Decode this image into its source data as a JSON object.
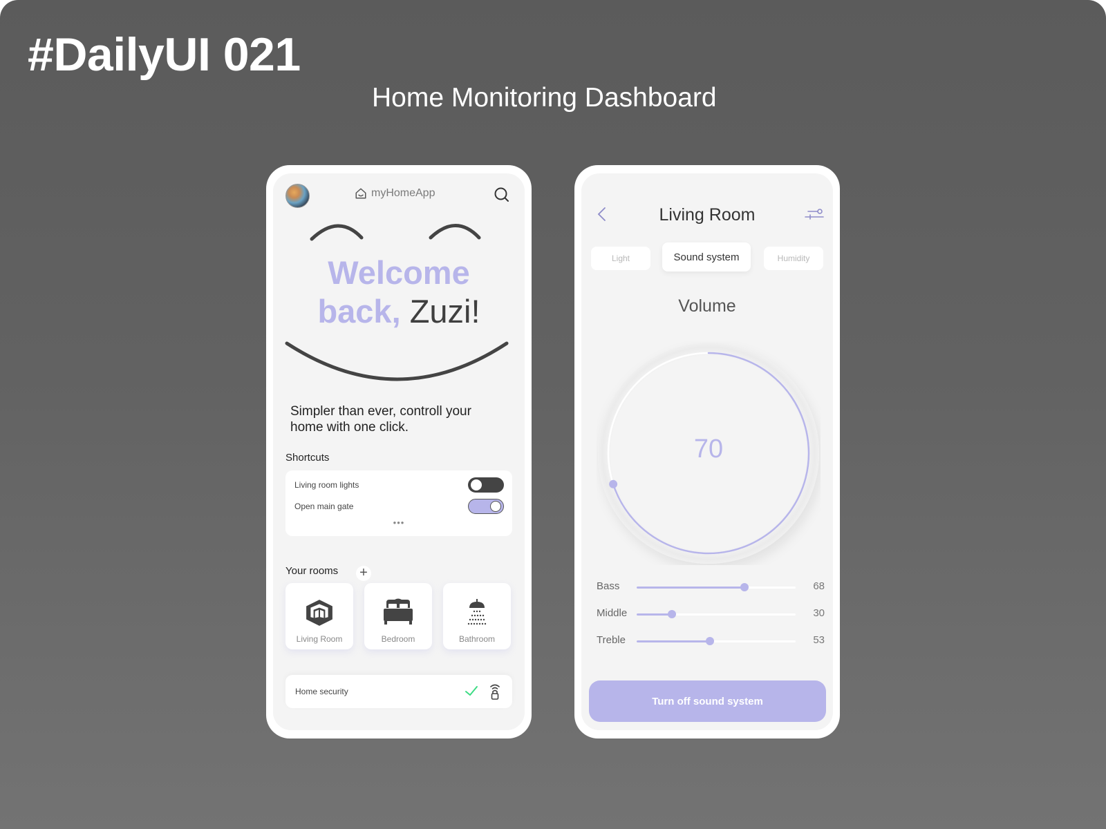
{
  "canvas": {
    "title": "#DailyUI 021",
    "subtitle": "Home Monitoring Dashboard"
  },
  "colors": {
    "accent": "#b7b5ea",
    "dark": "#444444",
    "success": "#2ecc71",
    "screen_bg": "#f4f4f4"
  },
  "home_screen": {
    "app_name": "myHomeApp",
    "avatar_icon": "user-avatar",
    "search_icon": "search-icon",
    "welcome_line1": "Welcome",
    "welcome_line2": "back,",
    "user_name": "Zuzi!",
    "tagline": "Simpler than ever, controll your home with one click.",
    "shortcuts": {
      "title": "Shortcuts",
      "items": [
        {
          "label": "Living room lights",
          "state": "off"
        },
        {
          "label": "Open main gate",
          "state": "on"
        }
      ],
      "more": "•••"
    },
    "rooms": {
      "title": "Your rooms",
      "add_label": "+",
      "items": [
        {
          "label": "Living Room",
          "icon": "living-room-icon"
        },
        {
          "label": "Bedroom",
          "icon": "bed-icon"
        },
        {
          "label": "Bathroom",
          "icon": "shower-icon"
        }
      ]
    },
    "security": {
      "label": "Home security",
      "status": "ok",
      "status_icon": "check-icon",
      "lock_icon": "wireless-lock-icon"
    }
  },
  "room_screen": {
    "title": "Living Room",
    "tabs": [
      {
        "label": "Light",
        "active": false
      },
      {
        "label": "Sound system",
        "active": true
      },
      {
        "label": "Humidity",
        "active": false
      }
    ],
    "volume": {
      "label": "Volume",
      "value": "70",
      "level_fraction": 0.7
    },
    "equalizer": [
      {
        "label": "Bass",
        "value": "68",
        "fraction": 0.68
      },
      {
        "label": "Middle",
        "value": "30",
        "fraction": 0.22
      },
      {
        "label": "Treble",
        "value": "53",
        "fraction": 0.46
      }
    ],
    "cta_label": "Turn off sound system"
  }
}
